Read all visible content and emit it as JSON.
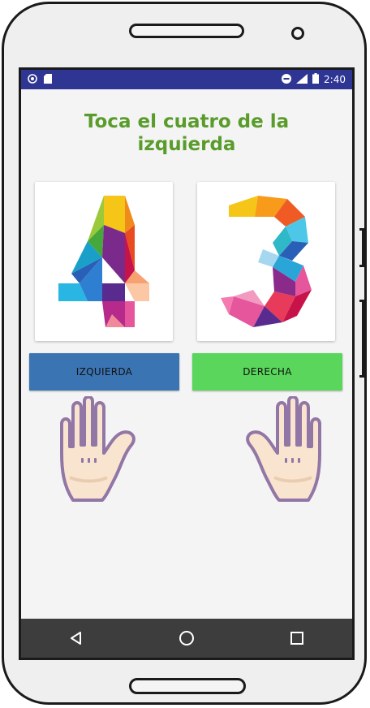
{
  "statusbar": {
    "time": "2:40",
    "left_icons": [
      "settings-circle-icon",
      "sd-card-icon"
    ],
    "right_icons": [
      "do-not-disturb-icon",
      "signal-icon",
      "battery-icon"
    ]
  },
  "prompt": {
    "title": "Toca el cuatro de la izquierda"
  },
  "cards": [
    {
      "digit": "4",
      "icon": "colorful-polygon-digit-four"
    },
    {
      "digit": "3",
      "icon": "colorful-polygon-digit-three"
    }
  ],
  "buttons": {
    "left_label": "IZQUIERDA",
    "right_label": "DERECHA",
    "left_color": "#3b74b2",
    "right_color": "#59d65b"
  },
  "hands": [
    "left-hand-icon",
    "right-hand-icon"
  ],
  "navbar": {
    "icons": [
      "back-icon",
      "home-icon",
      "recents-icon"
    ]
  },
  "colors": {
    "title": "#5a9c2b",
    "statusbar": "#2f3593",
    "navbar": "#3d3d3d"
  }
}
